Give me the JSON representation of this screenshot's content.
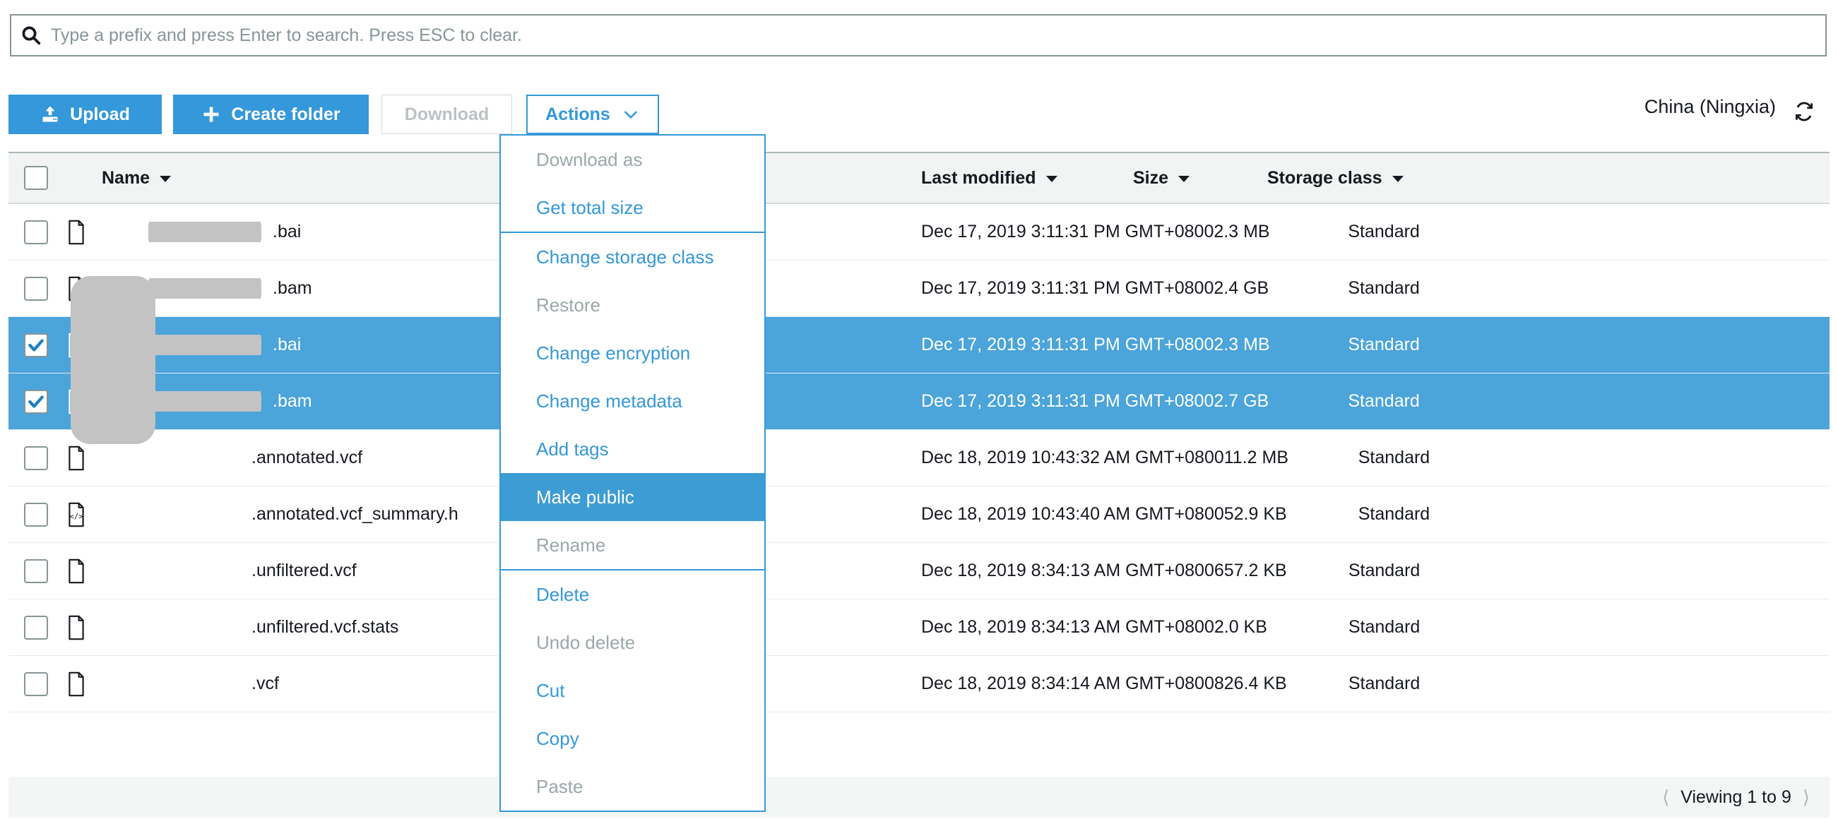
{
  "search": {
    "placeholder": "Type a prefix and press Enter to search. Press ESC to clear.",
    "value": "",
    "icon": "search-icon"
  },
  "toolbar": {
    "upload_label": "Upload",
    "upload_icon": "upload-icon",
    "create_folder_label": "Create folder",
    "create_folder_icon": "plus-icon",
    "download_label": "Download",
    "download_disabled": true,
    "actions_label": "Actions",
    "actions_caret_icon": "chevron-down-icon",
    "region_label": "China (Ningxia)",
    "refresh_icon": "refresh-icon"
  },
  "actions_menu": {
    "open": true,
    "items": [
      {
        "label": "Download as",
        "state": "disabled",
        "divider_after": false
      },
      {
        "label": "Get total size",
        "state": "enabled",
        "divider_after": true
      },
      {
        "label": "Change storage class",
        "state": "enabled",
        "divider_after": false
      },
      {
        "label": "Restore",
        "state": "disabled",
        "divider_after": false
      },
      {
        "label": "Change encryption",
        "state": "enabled",
        "divider_after": false
      },
      {
        "label": "Change metadata",
        "state": "enabled",
        "divider_after": false
      },
      {
        "label": "Add tags",
        "state": "enabled",
        "divider_after": false
      },
      {
        "label": "Make public",
        "state": "hover",
        "divider_after": false
      },
      {
        "label": "Rename",
        "state": "disabled",
        "divider_after": true
      },
      {
        "label": "Delete",
        "state": "enabled",
        "divider_after": false
      },
      {
        "label": "Undo delete",
        "state": "disabled",
        "divider_after": false
      },
      {
        "label": "Cut",
        "state": "enabled",
        "divider_after": false
      },
      {
        "label": "Copy",
        "state": "enabled",
        "divider_after": false
      },
      {
        "label": "Paste",
        "state": "disabled",
        "divider_after": false
      }
    ]
  },
  "table": {
    "columns": [
      {
        "key": "name",
        "label": "Name",
        "sortable": true
      },
      {
        "key": "modified",
        "label": "Last modified",
        "sortable": true
      },
      {
        "key": "size",
        "label": "Size",
        "sortable": true
      },
      {
        "key": "storage_class",
        "label": "Storage class",
        "sortable": true
      }
    ],
    "select_all_checked": false,
    "rows": [
      {
        "name": ".bai",
        "redacted": true,
        "file_icon": "file-icon",
        "modified": "Dec 17, 2019 3:11:31 PM GMT+0800",
        "size": "2.3 MB",
        "storage_class": "Standard",
        "selected": false
      },
      {
        "name": ".bam",
        "redacted": true,
        "file_icon": "file-icon",
        "modified": "Dec 17, 2019 3:11:31 PM GMT+0800",
        "size": "2.4 GB",
        "storage_class": "Standard",
        "selected": false
      },
      {
        "name": ".bai",
        "redacted": true,
        "file_icon": "file-icon",
        "modified": "Dec 17, 2019 3:11:31 PM GMT+0800",
        "size": "2.3 MB",
        "storage_class": "Standard",
        "selected": true
      },
      {
        "name": ".bam",
        "redacted": true,
        "file_icon": "file-icon",
        "modified": "Dec 17, 2019 3:11:31 PM GMT+0800",
        "size": "2.7 GB",
        "storage_class": "Standard",
        "selected": true
      },
      {
        "name": ".annotated.vcf",
        "redacted": true,
        "file_icon": "file-icon",
        "modified": "Dec 18, 2019 10:43:32 AM GMT+0800",
        "size": "11.2 MB",
        "storage_class": "Standard",
        "selected": false
      },
      {
        "name": ".annotated.vcf_summary.h",
        "redacted": true,
        "file_icon": "html-file-icon",
        "modified": "Dec 18, 2019 10:43:40 AM GMT+0800",
        "size": "52.9 KB",
        "storage_class": "Standard",
        "selected": false
      },
      {
        "name": ".unfiltered.vcf",
        "redacted": true,
        "file_icon": "file-icon",
        "modified": "Dec 18, 2019 8:34:13 AM GMT+0800",
        "size": "657.2 KB",
        "storage_class": "Standard",
        "selected": false
      },
      {
        "name": ".unfiltered.vcf.stats",
        "redacted": true,
        "file_icon": "file-icon",
        "modified": "Dec 18, 2019 8:34:13 AM GMT+0800",
        "size": "2.0 KB",
        "storage_class": "Standard",
        "selected": false
      },
      {
        "name": ".vcf",
        "redacted": true,
        "file_icon": "file-icon",
        "modified": "Dec 18, 2019 8:34:14 AM GMT+0800",
        "size": "826.4 KB",
        "storage_class": "Standard",
        "selected": false
      }
    ]
  },
  "footer": {
    "prev_icon": "chevron-left-icon",
    "viewing_label": "Viewing 1 to 9",
    "next_icon": "chevron-right-icon"
  },
  "colors": {
    "accent_blue": "#3498db",
    "selected_row": "#4ba4da",
    "hover_menu": "#3d9cd4",
    "header_bg": "#f2f3f3",
    "footer_bg": "#f4f6f6",
    "disabled_text": "#9ba7a8",
    "redaction": "#c3c3c3"
  }
}
